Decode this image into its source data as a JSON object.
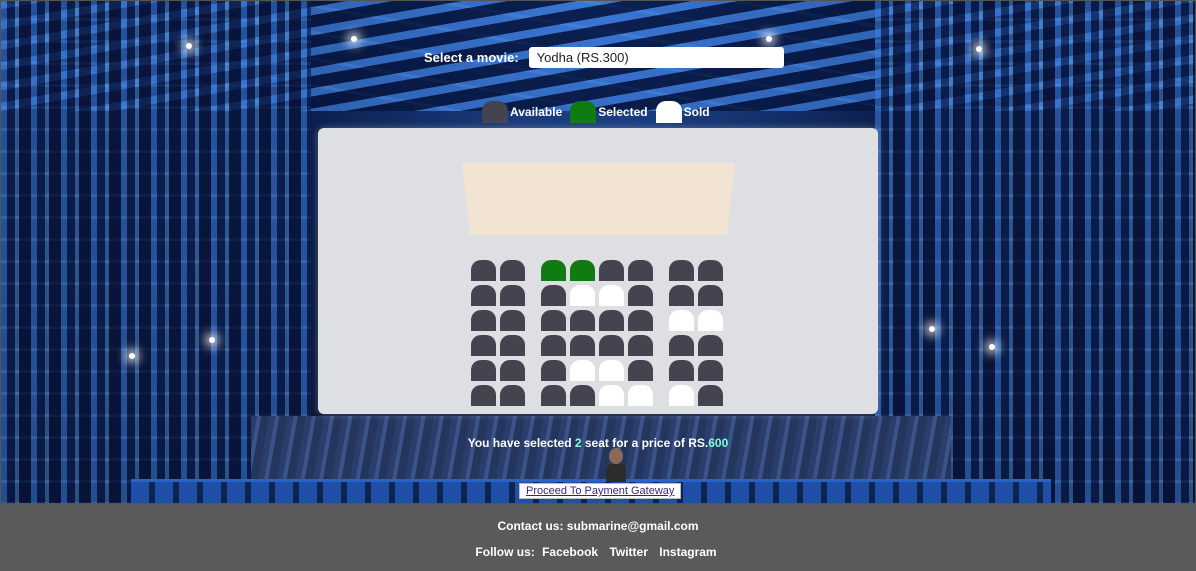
{
  "movie": {
    "label": "Select a movie:",
    "selected": "Yodha (RS.300)"
  },
  "legend": [
    {
      "label": "Available",
      "color": "#444451"
    },
    {
      "label": "Selected",
      "color": "#0f7b12"
    },
    {
      "label": "Sold",
      "color": "#ffffff"
    }
  ],
  "seat_rows": [
    [
      "available",
      "available",
      "gap",
      "selected",
      "selected",
      "available",
      "available",
      "gap",
      "available",
      "available"
    ],
    [
      "available",
      "available",
      "gap",
      "available",
      "sold",
      "sold",
      "available",
      "gap",
      "available",
      "available"
    ],
    [
      "available",
      "available",
      "gap",
      "available",
      "available",
      "available",
      "available",
      "gap",
      "sold",
      "sold"
    ],
    [
      "available",
      "available",
      "gap",
      "available",
      "available",
      "available",
      "available",
      "gap",
      "available",
      "available"
    ],
    [
      "available",
      "available",
      "gap",
      "available",
      "sold",
      "sold",
      "available",
      "gap",
      "available",
      "available"
    ],
    [
      "available",
      "available",
      "gap",
      "available",
      "available",
      "sold",
      "sold",
      "gap",
      "sold",
      "available"
    ]
  ],
  "summary": {
    "prefix": "You have selected ",
    "count": "2",
    "middle": " seat for a price of RS.",
    "price": "600"
  },
  "proceed_label": "Proceed To Payment Gateway",
  "footer": {
    "contact": "Contact us: submarine@gmail.com",
    "follow_label": "Follow us:",
    "links": [
      "Facebook",
      "Twitter",
      "Instagram"
    ]
  }
}
